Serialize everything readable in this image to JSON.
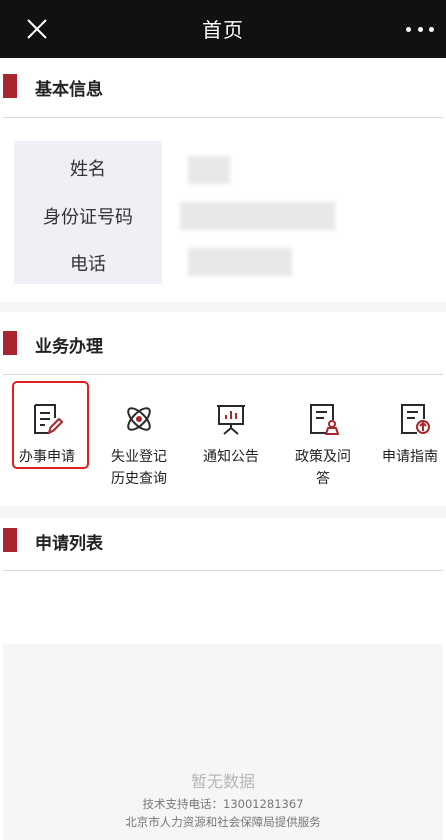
{
  "header": {
    "title": "首页"
  },
  "basic_info": {
    "section_title": "基本信息",
    "rows": [
      {
        "label": "姓名"
      },
      {
        "label": "身份证号码"
      },
      {
        "label": "电话"
      }
    ]
  },
  "business": {
    "section_title": "业务办理",
    "tiles": [
      {
        "name": "apply",
        "line1": "办事申请",
        "line2": "",
        "icon": "edit-document-icon"
      },
      {
        "name": "history",
        "line1": "失业登记",
        "line2": "历史查询",
        "icon": "atom-icon"
      },
      {
        "name": "notice",
        "line1": "通知公告",
        "line2": "",
        "icon": "presentation-board-icon"
      },
      {
        "name": "policy",
        "line1": "政策及问",
        "line2": "答",
        "icon": "policy-document-icon"
      },
      {
        "name": "guide",
        "line1": "申请指南",
        "line2": "",
        "icon": "guide-document-icon"
      }
    ]
  },
  "apply_list": {
    "section_title": "申请列表",
    "empty_text": "暂无数据"
  },
  "footer": {
    "support": "技术支持电话：13001281367",
    "provider": "北京市人力资源和社会保障局提供服务"
  },
  "colors": {
    "accent": "#a8262e",
    "highlight": "#e02020",
    "titlebar": "#111111"
  }
}
